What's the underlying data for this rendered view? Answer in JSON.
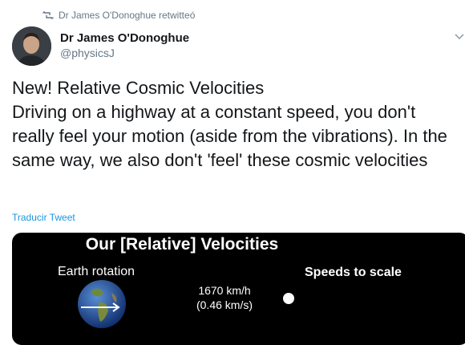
{
  "retweet": {
    "text": "Dr James O'Donoghue retwitteó",
    "icon": "retweet-icon"
  },
  "author": {
    "name": "Dr James O'Donoghue",
    "handle": "@physicsJ"
  },
  "tweet": {
    "text": "New! Relative Cosmic Velocities\nDriving on a highway at a constant speed, you don't really feel your motion (aside from the vibrations). In the same way, we also don't 'feel' these cosmic velocities"
  },
  "translate_label": "Traducir Tweet",
  "media": {
    "title": "Our [Relative] Velocities",
    "earth_label": "Earth rotation",
    "speeds_label": "Speeds to scale",
    "speed_line1": "1670 km/h",
    "speed_line2": "(0.46 km/s)"
  },
  "colors": {
    "link": "#1b95e0",
    "secondary": "#657786",
    "media_bg": "#000000"
  }
}
